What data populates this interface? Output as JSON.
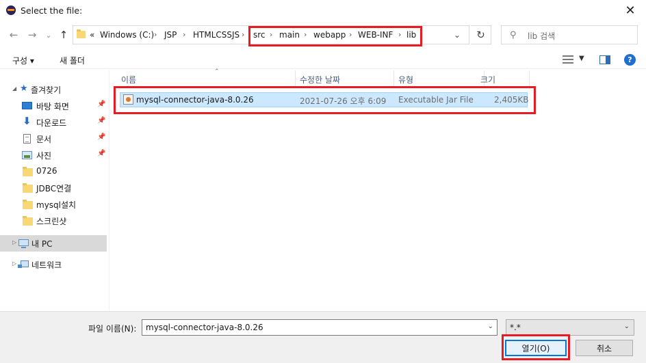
{
  "window": {
    "title": "Select the file:",
    "close_glyph": "✕"
  },
  "nav": {
    "back": "←",
    "forward": "→",
    "recent": "⌄",
    "up": "↑",
    "overflow": "«",
    "breadcrumbs": [
      "Windows (C:)",
      "JSP",
      "HTMLCSSJS",
      "src",
      "main",
      "webapp",
      "WEB-INF",
      "lib"
    ],
    "separator": "›",
    "dropdown": "⌄",
    "refresh": "↻",
    "search_icon": "⚲",
    "search_placeholder": "lib 검색"
  },
  "toolbar": {
    "organize": "구성 ▾",
    "new_folder": "새 폴더",
    "view_drop": "▼",
    "help": "?"
  },
  "sidebar": {
    "quick_access": "즐겨찾기",
    "items": [
      {
        "label": "바탕 화면",
        "icon": "desktop-icon",
        "pinned": true
      },
      {
        "label": "다운로드",
        "icon": "download-icon",
        "pinned": true
      },
      {
        "label": "문서",
        "icon": "document-icon",
        "pinned": true
      },
      {
        "label": "사진",
        "icon": "pictures-icon",
        "pinned": true
      },
      {
        "label": "0726",
        "icon": "folder-icon",
        "pinned": false
      },
      {
        "label": "JDBC연결",
        "icon": "folder-icon",
        "pinned": false
      },
      {
        "label": "mysql설치",
        "icon": "folder-icon",
        "pinned": false
      },
      {
        "label": "스크린샷",
        "icon": "folder-icon",
        "pinned": false
      }
    ],
    "this_pc": "내 PC",
    "network": "네트워크",
    "pin_glyph": "📌"
  },
  "columns": {
    "name": "이름",
    "modified": "수정한 날짜",
    "type": "유형",
    "size": "크기"
  },
  "files": [
    {
      "name": "mysql-connector-java-8.0.26",
      "modified": "2021-07-26 오후 6:09",
      "type": "Executable Jar File",
      "size": "2,405KB"
    }
  ],
  "footer": {
    "filename_label": "파일 이름(N):",
    "filename_value": "mysql-connector-java-8.0.26",
    "filetype_value": "*.*",
    "open_label": "열기(O)",
    "cancel_label": "취소",
    "dropdown": "⌄"
  },
  "colors": {
    "highlight": "#e51c23",
    "selection": "#cce8ff",
    "accent": "#0078d7"
  }
}
